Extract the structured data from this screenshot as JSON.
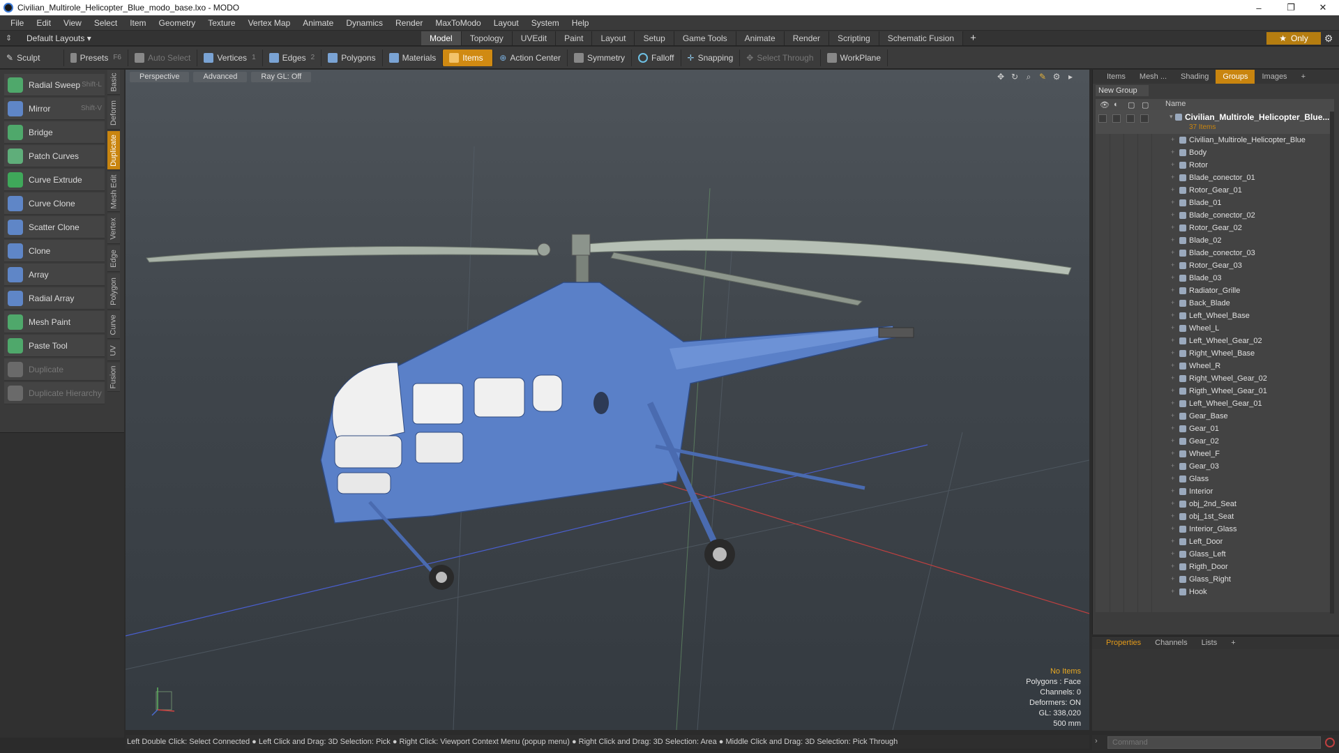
{
  "window": {
    "title": "Civilian_Multirole_Helicopter_Blue_modo_base.lxo - MODO",
    "controls": [
      "–",
      "❐",
      "✕"
    ]
  },
  "menu": [
    "File",
    "Edit",
    "View",
    "Select",
    "Item",
    "Geometry",
    "Texture",
    "Vertex Map",
    "Animate",
    "Dynamics",
    "Render",
    "MaxToModo",
    "Layout",
    "System",
    "Help"
  ],
  "layout_bar": {
    "layouts_label": "Default Layouts ▾",
    "tabs": [
      "Model",
      "Topology",
      "UVEdit",
      "Paint",
      "Layout",
      "Setup",
      "Game Tools",
      "Animate",
      "Render",
      "Scripting",
      "Schematic Fusion"
    ],
    "active_tab": "Model",
    "add": "+",
    "only_label": "Only",
    "only_star": "★"
  },
  "toolbar": {
    "sculpt": "Sculpt",
    "presets": "Presets",
    "presets_key": "F6",
    "auto_select": "Auto Select",
    "vertices": "Vertices",
    "vertices_num": "1",
    "edges": "Edges",
    "edges_num": "2",
    "polygons": "Polygons",
    "materials": "Materials",
    "items": "Items",
    "action_center": "Action Center",
    "symmetry": "Symmetry",
    "falloff": "Falloff",
    "snapping": "Snapping",
    "select_through": "Select Through",
    "workplane": "WorkPlane"
  },
  "tools": [
    {
      "label": "Radial Sweep",
      "shortcut": "Shift-L",
      "color": "#4fa86b",
      "dim": false
    },
    {
      "label": "Mirror",
      "shortcut": "Shift-V",
      "color": "#5f86c7",
      "dim": false
    },
    {
      "label": "Bridge",
      "shortcut": "",
      "color": "#4fa86b",
      "dim": false
    },
    {
      "label": "Patch Curves",
      "shortcut": "",
      "color": "#5fae7a",
      "dim": false
    },
    {
      "label": "Curve Extrude",
      "shortcut": "",
      "color": "#3fa85a",
      "dim": false
    },
    {
      "label": "Curve Clone",
      "shortcut": "",
      "color": "#5f86c7",
      "dim": false
    },
    {
      "label": "Scatter Clone",
      "shortcut": "",
      "color": "#5f86c7",
      "dim": false
    },
    {
      "label": "Clone",
      "shortcut": "",
      "color": "#5f86c7",
      "dim": false
    },
    {
      "label": "Array",
      "shortcut": "",
      "color": "#5f86c7",
      "dim": false
    },
    {
      "label": "Radial Array",
      "shortcut": "",
      "color": "#5f86c7",
      "dim": false
    },
    {
      "label": "Mesh Paint",
      "shortcut": "",
      "color": "#4fa86b",
      "dim": false
    },
    {
      "label": "Paste Tool",
      "shortcut": "",
      "color": "#4fa86b",
      "dim": false
    },
    {
      "label": "Duplicate",
      "shortcut": "",
      "color": "#6a6a6a",
      "dim": true
    },
    {
      "label": "Duplicate Hierarchy",
      "shortcut": "",
      "color": "#6a6a6a",
      "dim": true
    }
  ],
  "side_tabs": [
    "Basic",
    "Deform",
    "Duplicate",
    "Mesh Edit",
    "Vertex",
    "Edge",
    "Polygon",
    "Curve",
    "UV",
    "Fusion"
  ],
  "active_side_tab": "Duplicate",
  "viewport": {
    "tabs": [
      "Perspective",
      "Advanced",
      "Ray GL: Off"
    ],
    "stats": [
      "No Items",
      "Polygons : Face",
      "Channels: 0",
      "Deformers: ON",
      "GL: 338,020",
      "500 mm"
    ]
  },
  "status_bar": "Left Double Click: Select Connected ● Left Click and Drag: 3D Selection: Pick ● Right Click: Viewport Context Menu (popup menu) ● Right Click and Drag: 3D Selection: Area ● Middle Click and Drag: 3D Selection: Pick Through",
  "right_panel": {
    "tabs": [
      "Items",
      "Mesh ...",
      "Shading",
      "Groups",
      "Images",
      "+"
    ],
    "active_tab": "Groups",
    "new_group": "New Group",
    "name_header": "Name",
    "root_label": "Civilian_Multirole_Helicopter_Blue...",
    "root_count": "37 Items",
    "items": [
      "Civilian_Multirole_Helicopter_Blue",
      "Body",
      "Rotor",
      "Blade_conector_01",
      "Rotor_Gear_01",
      "Blade_01",
      "Blade_conector_02",
      "Rotor_Gear_02",
      "Blade_02",
      "Blade_conector_03",
      "Rotor_Gear_03",
      "Blade_03",
      "Radiator_Grille",
      "Back_Blade",
      "Left_Wheel_Base",
      "Wheel_L",
      "Left_Wheel_Gear_02",
      "Right_Wheel_Base",
      "Wheel_R",
      "Right_Wheel_Gear_02",
      "Rigth_Wheel_Gear_01",
      "Left_Wheel_Gear_01",
      "Gear_Base",
      "Gear_01",
      "Gear_02",
      "Wheel_F",
      "Gear_03",
      "Glass",
      "Interior",
      "obj_2nd_Seat",
      "obj_1st_Seat",
      "Interior_Glass",
      "Left_Door",
      "Glass_Left",
      "Rigth_Door",
      "Glass_Right",
      "Hook"
    ]
  },
  "properties": {
    "tabs": [
      "Properties",
      "Channels",
      "Lists",
      "+"
    ],
    "active_tab": "Properties"
  },
  "command": {
    "placeholder": "Command"
  }
}
